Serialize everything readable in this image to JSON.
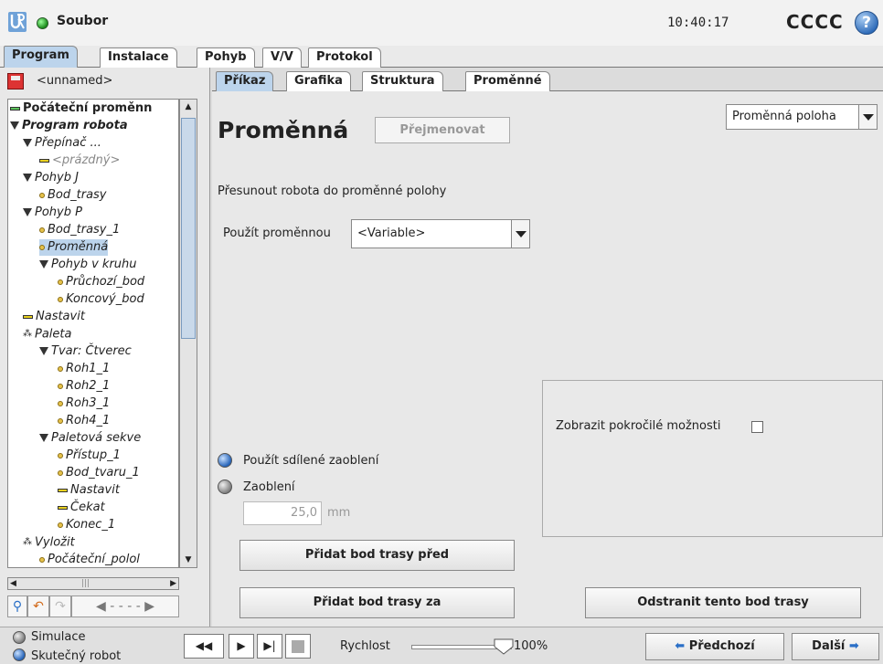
{
  "topbar": {
    "file_label": "Soubor",
    "time": "10:40:17",
    "robot_name": "CCCC",
    "help_label": "?"
  },
  "main_tabs": [
    {
      "label": "Program",
      "active": true
    },
    {
      "label": "Instalace",
      "active": false
    },
    {
      "label": "Pohyb",
      "active": false
    },
    {
      "label": "V/V",
      "active": false
    },
    {
      "label": "Protokol",
      "active": false
    }
  ],
  "program": {
    "name": "<unnamed>"
  },
  "tree": [
    {
      "label": "Počáteční proměnn",
      "marker": "bar-green",
      "style": "bold-normal",
      "level": 0
    },
    {
      "label": "Program robota",
      "marker": "tri",
      "style": "bold",
      "level": 0
    },
    {
      "label": "Přepínač ...",
      "marker": "tri",
      "style": "italic",
      "level": 1
    },
    {
      "label": "<prázdný>",
      "marker": "bar",
      "style": "dim",
      "level": 2
    },
    {
      "label": "Pohyb J",
      "marker": "tri",
      "style": "italic",
      "level": 1
    },
    {
      "label": "Bod_trasy",
      "marker": "dot",
      "style": "italic",
      "level": 2
    },
    {
      "label": "Pohyb P",
      "marker": "tri",
      "style": "italic",
      "level": 1
    },
    {
      "label": "Bod_trasy_1",
      "marker": "dot",
      "style": "italic",
      "level": 2
    },
    {
      "label": "Proměnná",
      "marker": "dot",
      "style": "selected",
      "level": 2
    },
    {
      "label": "Pohyb v kruhu",
      "marker": "tri",
      "style": "italic",
      "level": 2
    },
    {
      "label": "Průchozí_bod",
      "marker": "dot",
      "style": "italic",
      "level": 3
    },
    {
      "label": "Koncový_bod",
      "marker": "dot",
      "style": "italic",
      "level": 3
    },
    {
      "label": "Nastavit",
      "marker": "bar",
      "style": "italic",
      "level": 1
    },
    {
      "label": "Paleta",
      "marker": "pal",
      "style": "italic",
      "level": 1
    },
    {
      "label": "Tvar: Čtverec",
      "marker": "tri",
      "style": "italic",
      "level": 2
    },
    {
      "label": "Roh1_1",
      "marker": "dot",
      "style": "italic",
      "level": 3
    },
    {
      "label": "Roh2_1",
      "marker": "dot",
      "style": "italic",
      "level": 3
    },
    {
      "label": "Roh3_1",
      "marker": "dot",
      "style": "italic",
      "level": 3
    },
    {
      "label": "Roh4_1",
      "marker": "dot",
      "style": "italic",
      "level": 3
    },
    {
      "label": "Paletová sekve",
      "marker": "tri",
      "style": "italic",
      "level": 2
    },
    {
      "label": "Přístup_1",
      "marker": "dot",
      "style": "italic",
      "level": 3
    },
    {
      "label": "Bod_tvaru_1",
      "marker": "dot",
      "style": "italic",
      "level": 3
    },
    {
      "label": "Nastavit",
      "marker": "bar",
      "style": "italic",
      "level": 3
    },
    {
      "label": "Čekat",
      "marker": "bar",
      "style": "italic",
      "level": 3
    },
    {
      "label": "Konec_1",
      "marker": "dot",
      "style": "italic",
      "level": 3
    },
    {
      "label": "Vyložit",
      "marker": "pal",
      "style": "italic",
      "level": 1
    },
    {
      "label": "Počáteční_polol",
      "marker": "dot",
      "style": "italic",
      "level": 2
    }
  ],
  "sub_tabs": [
    {
      "label": "Příkaz",
      "active": true
    },
    {
      "label": "Grafika",
      "active": false
    },
    {
      "label": "Struktura",
      "active": false
    },
    {
      "label": "Proměnné",
      "active": false
    }
  ],
  "command": {
    "title": "Proměnná",
    "rename_label": "Přejmenovat",
    "type_select": "Proměnná poloha",
    "description": "Přesunout robota do proměnné polohy",
    "use_variable_label": "Použít proměnnou",
    "variable_select": "<Variable>",
    "shared_blend_label": "Použít sdílené zaoblení",
    "shared_blend_selected": true,
    "blend_label": "Zaoblení",
    "blend_value": "25,0",
    "blend_unit": "mm",
    "advanced_label": "Zobrazit pokročilé možnosti",
    "advanced_checked": false,
    "add_before_label": "Přidat bod trasy před",
    "add_after_label": "Přidat bod trasy za",
    "remove_label": "Odstranit tento bod trasy"
  },
  "bottombar": {
    "simulation_label": "Simulace",
    "real_robot_label": "Skutečný robot",
    "real_robot_selected": true,
    "speed_label": "Rychlost",
    "speed_value": "100%",
    "speed_fraction": 1.0,
    "prev_label": "Předchozí",
    "next_label": "Další"
  }
}
